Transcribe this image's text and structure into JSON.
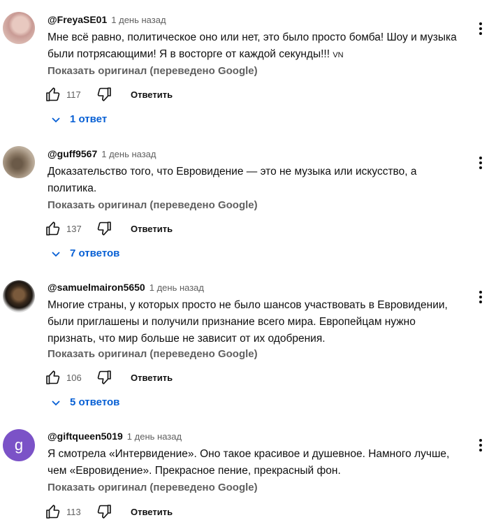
{
  "comments": [
    {
      "avatar_letter": "",
      "author": "@FreyaSE01",
      "time": "1 день назад",
      "lines": [
        "Мне всё равно, политическое оно или нет, это было просто бомба! Шоу и музыка",
        "были потрясающими! Я в восторге от каждой секунды!!!"
      ],
      "suffix": "VN",
      "translate": "Показать оригинал (переведено Google)",
      "likes": "117",
      "reply_label": "Ответить",
      "replies_label": "1 ответ"
    },
    {
      "avatar_letter": "",
      "author": "@guff9567",
      "time": "1 день назад",
      "lines": [
        "Доказательство того, что Евровидение — это не музыка или искусство, а",
        "политика."
      ],
      "suffix": "",
      "translate": "Показать оригинал (переведено Google)",
      "likes": "137",
      "reply_label": "Ответить",
      "replies_label": "7 ответов"
    },
    {
      "avatar_letter": "",
      "author": "@samuelmairon5650",
      "time": "1 день назад",
      "lines": [
        "Многие страны, у которых просто не было шансов участвовать в Евровидении,",
        "были приглашены и получили признание всего мира. Европейцам нужно",
        "признать, что мир больше не зависит от их одобрения."
      ],
      "suffix": "",
      "translate": "Показать оригинал (переведено Google)",
      "likes": "106",
      "reply_label": "Ответить",
      "replies_label": "5 ответов"
    },
    {
      "avatar_letter": "g",
      "author": "@giftqueen5019",
      "time": "1 день назад",
      "lines": [
        "Я смотрела «Интервидение». Оно такое красивое и душевное. Намного лучше,",
        "чем «Евровидение». Прекрасное пение, прекрасный фон."
      ],
      "suffix": "",
      "translate": "Показать оригинал (переведено Google)",
      "likes": "113",
      "reply_label": "Ответить",
      "replies_label": ""
    }
  ],
  "colors": {
    "link": "#065fd4",
    "muted": "#606060",
    "text": "#0f0f0f",
    "avatar_g": "#7b52c7"
  },
  "icons": [
    "thumb-up-icon",
    "thumb-down-icon",
    "chevron-down-icon",
    "more-vert-icon"
  ]
}
